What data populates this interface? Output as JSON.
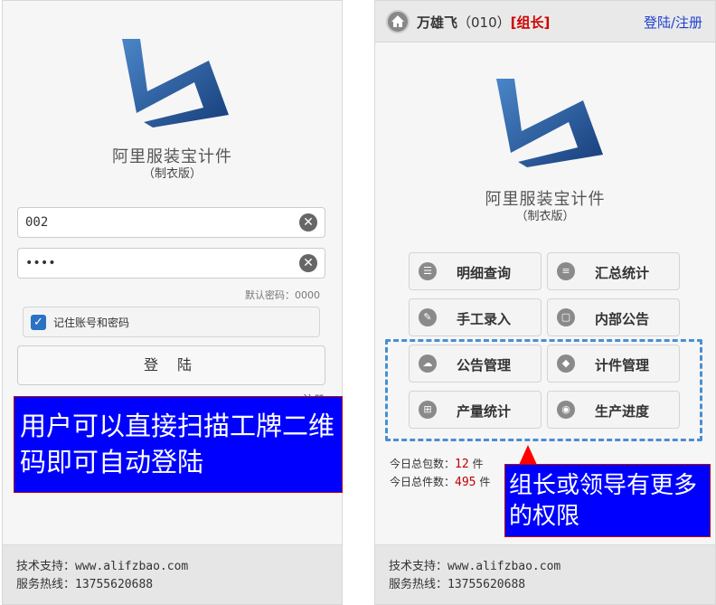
{
  "left": {
    "app_name": "阿里服装宝计件",
    "app_edition": "（制衣版）",
    "username_value": "002",
    "password_value": "••••",
    "default_password_hint": "默认密码：0000",
    "remember_label": "记住账号和密码",
    "remember_checked": true,
    "login_button": "登 陆",
    "register_partial": "注册",
    "callout": "用户可以直接扫描工牌二维码即可自动登陆",
    "footer": {
      "support": "技术支持：www.alifzbao.com",
      "hotline": "服务热线：13755620688"
    }
  },
  "right": {
    "header": {
      "user_name": "万雄飞",
      "user_code": "（010）",
      "user_role": "[组长]",
      "login_register": "登陆/注册"
    },
    "app_name": "阿里服装宝计件",
    "app_edition": "（制衣版）",
    "menu": [
      {
        "label": "明细查询",
        "icon": "list-icon"
      },
      {
        "label": "汇总统计",
        "icon": "menu-icon"
      },
      {
        "label": "手工录入",
        "icon": "pencil-icon"
      },
      {
        "label": "内部公告",
        "icon": "chat-icon"
      },
      {
        "label": "公告管理",
        "icon": "cloud-icon"
      },
      {
        "label": "计件管理",
        "icon": "tag-icon"
      },
      {
        "label": "产量统计",
        "icon": "grid-icon"
      },
      {
        "label": "生产进度",
        "icon": "eye-icon"
      }
    ],
    "stats": {
      "packages_label": "今日总包数：",
      "packages_value": "12",
      "packages_unit": "件",
      "pieces_label": "今日总件数：",
      "pieces_value": "495",
      "pieces_unit": "件"
    },
    "callout": "组长或领导有更多的权限",
    "footer": {
      "support": "技术支持：www.alifzbao.com",
      "hotline": "服务热线：13755620688"
    }
  },
  "colors": {
    "callout_bg": "#0000ff",
    "callout_border": "#c00000",
    "role_red": "#d00000",
    "link_blue": "#1f3ecf",
    "logo_blue": "#1f5aa8",
    "dash_blue": "#4a8fd0"
  }
}
